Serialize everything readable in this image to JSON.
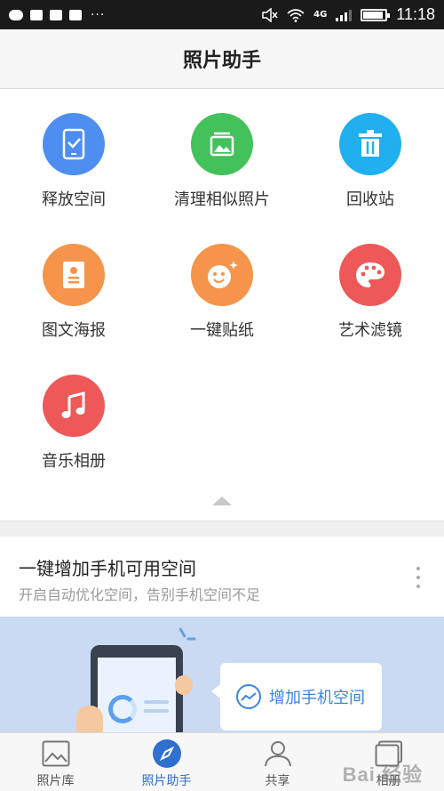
{
  "status_bar": {
    "network": "4G",
    "time": "11:18",
    "battery_level": 0.9,
    "signal_bars": 3
  },
  "header": {
    "title": "照片助手"
  },
  "tools": [
    {
      "label": "释放空间",
      "icon": "phone-clean-icon",
      "color": "#4d8ef0"
    },
    {
      "label": "清理相似照片",
      "icon": "similar-photos-icon",
      "color": "#43c15b"
    },
    {
      "label": "回收站",
      "icon": "trash-icon",
      "color": "#20b0ef"
    },
    {
      "label": "图文海报",
      "icon": "poster-icon",
      "color": "#f5944a"
    },
    {
      "label": "一键贴纸",
      "icon": "sticker-face-icon",
      "color": "#f5944a"
    },
    {
      "label": "艺术滤镜",
      "icon": "palette-icon",
      "color": "#ef5858"
    },
    {
      "label": "音乐相册",
      "icon": "music-note-icon",
      "color": "#ef5858"
    }
  ],
  "promo_card": {
    "title": "一键增加手机可用空间",
    "subtitle": "开启自动优化空间，告别手机空间不足",
    "button_label": "增加手机空间"
  },
  "bottom_nav": {
    "items": [
      {
        "label": "照片库",
        "icon": "image-icon",
        "active": false
      },
      {
        "label": "照片助手",
        "icon": "compass-icon",
        "active": true
      },
      {
        "label": "共享",
        "icon": "people-icon",
        "active": false
      },
      {
        "label": "相册",
        "icon": "album-icon",
        "active": false
      }
    ]
  },
  "watermark": "Bai 经验",
  "colors": {
    "accent": "#2f6fd0",
    "banner_bg": "#c9daf2"
  }
}
